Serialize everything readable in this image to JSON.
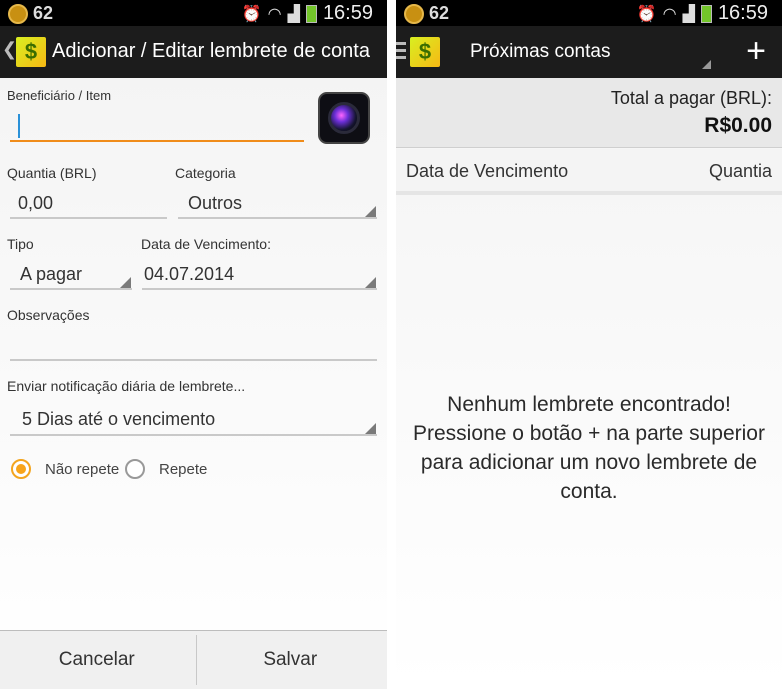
{
  "status_bar": {
    "notification_count": "62",
    "time": "16:59"
  },
  "left_screen": {
    "title": "Adicionar / Editar lembrete de conta",
    "beneficiary": {
      "label": "Beneficiário / Item",
      "value": ""
    },
    "amount": {
      "label": "Quantia (BRL)",
      "value": "0,00"
    },
    "category": {
      "label": "Categoria",
      "value": "Outros"
    },
    "type": {
      "label": "Tipo",
      "value": "A pagar"
    },
    "due_date": {
      "label": "Data de Vencimento:",
      "value": "04.07.2014"
    },
    "notes": {
      "label": "Observações",
      "value": ""
    },
    "reminder": {
      "label": "Enviar notificação diária de lembrete...",
      "value": "5 Dias até o vencimento"
    },
    "repeat_options": [
      {
        "label": "Não repete",
        "selected": true
      },
      {
        "label": "Repete",
        "selected": false
      }
    ],
    "buttons": {
      "cancel": "Cancelar",
      "save": "Salvar"
    }
  },
  "right_screen": {
    "title": "Próximas contas",
    "total_label": "Total a pagar (BRL):",
    "total_amount": "R$0.00",
    "columns": [
      "Data de Vencimento",
      "Quantia"
    ],
    "empty_message": "Nenhum lembrete encontrado! Pressione o botão + na parte superior para adicionar um novo lembrete de conta."
  },
  "icons": {
    "app": "dollar-app-icon",
    "camera": "camera-icon",
    "add": "plus-icon",
    "menu": "hamburger-icon",
    "back": "back-chevron-icon"
  },
  "colors": {
    "accent": "#f08c1a",
    "actionbar": "#1c1c1c",
    "statusbar": "#000000"
  }
}
